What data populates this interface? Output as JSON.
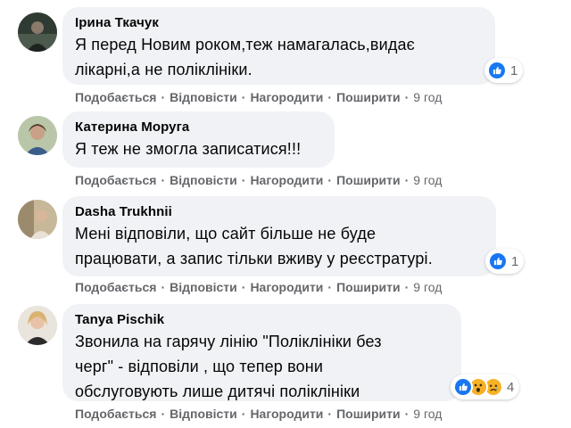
{
  "comments": [
    {
      "author": "Ірина Ткачук",
      "text": "Я перед Новим роком,теж намагалась,видає\nлікарні,а не поліклініки.",
      "reaction_count": "1",
      "reaction_icons": [
        "like-icon"
      ],
      "actions": {
        "like": "Подобається",
        "reply": "Відповісти",
        "reward": "Нагородити",
        "share": "Поширити"
      },
      "time": "9 год"
    },
    {
      "author": "Катерина Моруга",
      "text": "Я теж не змогла записатися!!!",
      "actions": {
        "like": "Подобається",
        "reply": "Відповісти",
        "reward": "Нагородити",
        "share": "Поширити"
      },
      "time": "9 год"
    },
    {
      "author": "Dasha Trukhnii",
      "text": "Мені відповіли, що сайт більше не буде\nпрацювати, а запис тільки вживу у реєстратурі.",
      "reaction_count": "1",
      "reaction_icons": [
        "like-icon"
      ],
      "actions": {
        "like": "Подобається",
        "reply": "Відповісти",
        "reward": "Нагородити",
        "share": "Поширити"
      },
      "time": "9 год"
    },
    {
      "author": "Tanya Pischik",
      "text": "Звонила на гарячу лінію \"Поліклініки без\nчерг\" - відповіли , що тепер вони\nобслуговують лише дитячі поліклініки",
      "reaction_count": "4",
      "reaction_icons": [
        "like-icon",
        "wow-icon",
        "sad-icon"
      ],
      "actions": {
        "like": "Подобається",
        "reply": "Відповісти",
        "reward": "Нагородити",
        "share": "Поширити"
      },
      "time": "9 год"
    }
  ],
  "colors": {
    "bubble": "#f0f2f5",
    "meta_text": "#65676b",
    "like_blue": "#1877f2",
    "emoji_yellow": "#f7b125"
  }
}
